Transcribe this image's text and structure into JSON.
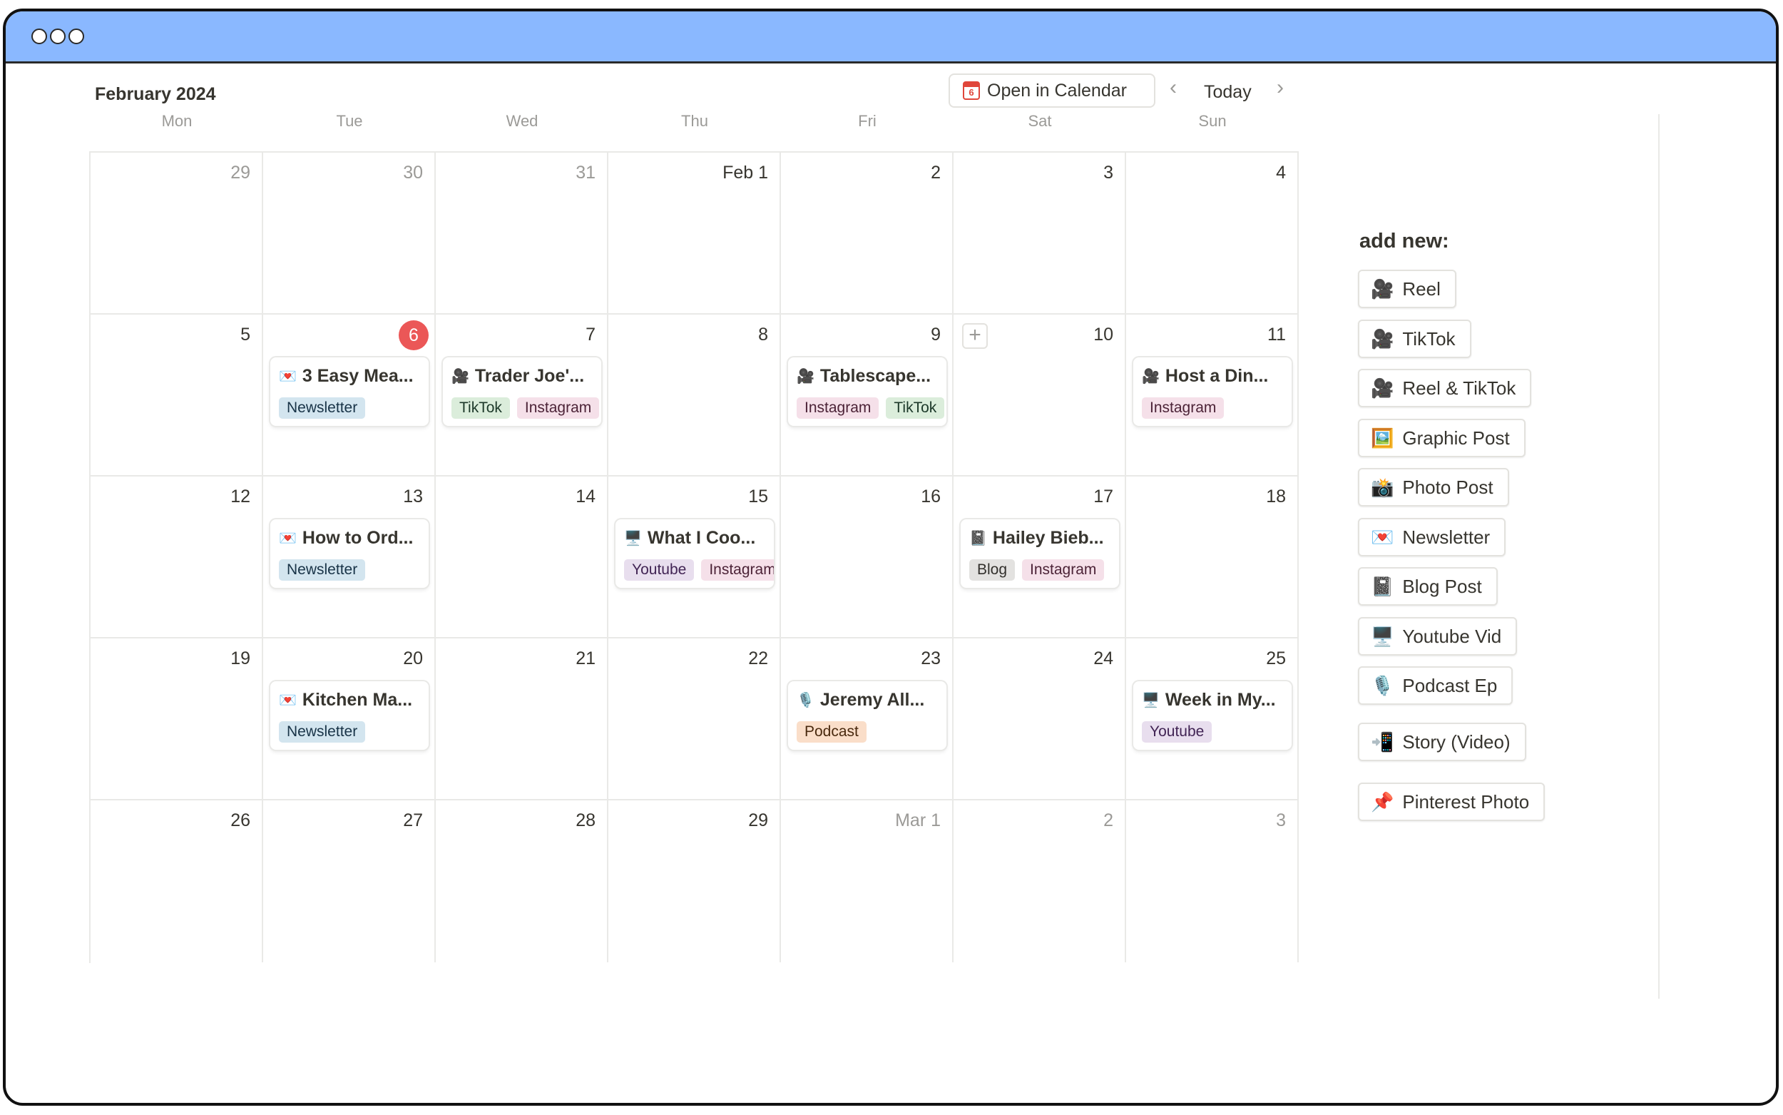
{
  "calendar": {
    "month_title": "February 2024",
    "open_in_calendar": "Open in Calendar",
    "calendar_icon_day": "6",
    "prev_icon": "‹",
    "today": "Today",
    "next_icon": "›",
    "plus_icon": "+",
    "weekdays": [
      "Mon",
      "Tue",
      "Wed",
      "Thu",
      "Fri",
      "Sat",
      "Sun"
    ],
    "weeks": [
      [
        {
          "label": "29",
          "muted": true
        },
        {
          "label": "30",
          "muted": true
        },
        {
          "label": "31",
          "muted": true
        },
        {
          "label": "Feb 1"
        },
        {
          "label": "2"
        },
        {
          "label": "3"
        },
        {
          "label": "4"
        }
      ],
      [
        {
          "label": "5"
        },
        {
          "label": "6",
          "today": true,
          "card": {
            "icon": "💌",
            "title": "3 Easy Mea...",
            "tags": [
              "Newsletter"
            ]
          }
        },
        {
          "label": "7",
          "card": {
            "icon": "🎥",
            "title": "Trader Joe'...",
            "tags": [
              "TikTok",
              "Instagram"
            ]
          }
        },
        {
          "label": "8"
        },
        {
          "label": "9",
          "card": {
            "icon": "🎥",
            "title": "Tablescape...",
            "tags": [
              "Instagram",
              "TikTok"
            ]
          }
        },
        {
          "label": "10",
          "plus": true
        },
        {
          "label": "11",
          "card": {
            "icon": "🎥",
            "title": "Host a Din...",
            "tags": [
              "Instagram"
            ]
          }
        }
      ],
      [
        {
          "label": "12"
        },
        {
          "label": "13",
          "card": {
            "icon": "💌",
            "title": "How to Ord...",
            "tags": [
              "Newsletter"
            ]
          }
        },
        {
          "label": "14"
        },
        {
          "label": "15",
          "card": {
            "icon": "🖥️",
            "title": "What I Coo...",
            "tags": [
              "Youtube",
              "Instagram"
            ]
          }
        },
        {
          "label": "16"
        },
        {
          "label": "17",
          "card": {
            "icon": "📓",
            "title": "Hailey Bieb...",
            "tags": [
              "Blog",
              "Instagram"
            ]
          }
        },
        {
          "label": "18"
        }
      ],
      [
        {
          "label": "19"
        },
        {
          "label": "20",
          "card": {
            "icon": "💌",
            "title": "Kitchen Ma...",
            "tags": [
              "Newsletter"
            ]
          }
        },
        {
          "label": "21"
        },
        {
          "label": "22"
        },
        {
          "label": "23",
          "card": {
            "icon": "🎙️",
            "title": "Jeremy All...",
            "tags": [
              "Podcast"
            ]
          }
        },
        {
          "label": "24"
        },
        {
          "label": "25",
          "card": {
            "icon": "🖥️",
            "title": "Week in My...",
            "tags": [
              "Youtube"
            ]
          }
        }
      ],
      [
        {
          "label": "26"
        },
        {
          "label": "27"
        },
        {
          "label": "28"
        },
        {
          "label": "29"
        },
        {
          "label": "Mar 1",
          "muted": true
        },
        {
          "label": "2",
          "muted": true
        },
        {
          "label": "3",
          "muted": true
        }
      ]
    ]
  },
  "add_new": {
    "title": "add new:",
    "buttons": [
      {
        "icon": "🎥",
        "label": "Reel"
      },
      {
        "icon": "🎥",
        "label": "TikTok"
      },
      {
        "icon": "🎥",
        "label": "Reel & TikTok"
      },
      {
        "icon": "🖼️",
        "label": "Graphic Post"
      },
      {
        "icon": "📸",
        "label": "Photo Post"
      },
      {
        "icon": "💌",
        "label": "Newsletter"
      },
      {
        "icon": "📓",
        "label": "Blog Post"
      },
      {
        "icon": "🖥️",
        "label": "Youtube Vid"
      },
      {
        "icon": "🎙️",
        "label": "Podcast Ep"
      },
      {
        "icon": "📲",
        "label": "Story (Video)"
      },
      {
        "icon": "📌",
        "label": "Pinterest Photo"
      }
    ]
  },
  "colors": {
    "titlebar": "#8ab8ff",
    "today_badge": "#eb5757",
    "tag_newsletter": "#d3e5ef",
    "tag_tiktok": "#dbeddb",
    "tag_instagram": "#f5e0e9",
    "tag_youtube": "#e8deee",
    "tag_blog": "#e3e2e0",
    "tag_podcast": "#fadec9"
  }
}
